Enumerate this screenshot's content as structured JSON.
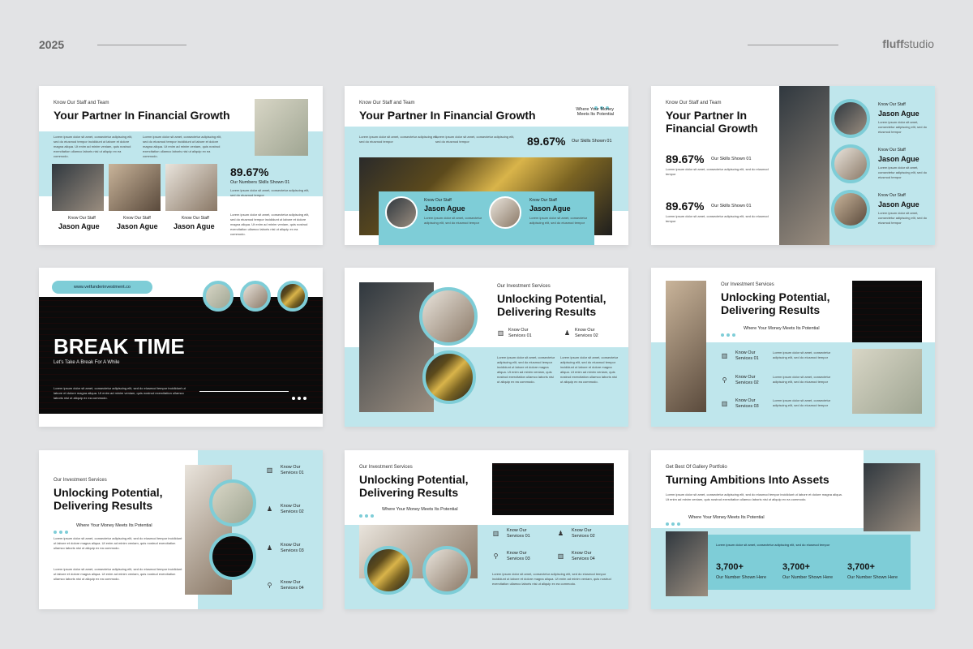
{
  "header": {
    "year": "2025",
    "brand_bold": "fluff",
    "brand_light": "studio"
  },
  "common": {
    "kicker_staff": "Know Our Staff and Team",
    "title_partner": "Your Partner In Financial Growth",
    "title_partner_l1": "Your Partner In",
    "title_partner_l2": "Financial Growth",
    "kicker_services": "Our Investment Services",
    "title_unlock_l1": "Unlocking Potential,",
    "title_unlock_l2": "Delivering Results",
    "tagline": "Where Your Money Meets Its Potential",
    "tagline_l1": "Where Your Money",
    "tagline_l2": "Meets Its Potential",
    "lorem": "Lorem ipsum dolor sit amet, consectetur adipiscing elit, sed do eiusmod tempor incididunt ut labore et dolore magna aliqua. Ut enim ad minim veniam, quis nostrud exercitation ullamco laboris nisi ut aliquip ex ea commodo.",
    "lorem_short": "Lorem ipsum dolor sit amet, consectetur adipiscing elit, sed do eiusmod tempor",
    "know_staff": "Know Our Staff",
    "staff_name": "Jason Ague",
    "percent": "89.67%",
    "skills": "Our Skills Shown 01",
    "numbers_skills": "Our Numbers Skills Shown 01",
    "svc01": "Know Our Services 01",
    "svc02": "Know Our Services 02",
    "svc03": "Know Our Services 03",
    "svc04": "Know Our Services 04",
    "svc_l1": "Know Our",
    "svc_01": "Services 01",
    "svc_02": "Services 02",
    "svc_03": "Services 03",
    "svc_04": "Services 04"
  },
  "break": {
    "url": "www.vetfunderinvestment.co",
    "title": "BREAK TIME",
    "subtitle": "Let's Take A Break For A While"
  },
  "portfolio": {
    "kicker": "Get Best Of Gallery Portfolio",
    "title": "Turning Ambitions Into Assets",
    "stat": "3,700+",
    "stat_label": "Our Number Shown Here"
  },
  "icons": {
    "chart": "bar-chart-icon",
    "search": "search-icon",
    "people": "people-icon",
    "dots": "dots-icon"
  }
}
